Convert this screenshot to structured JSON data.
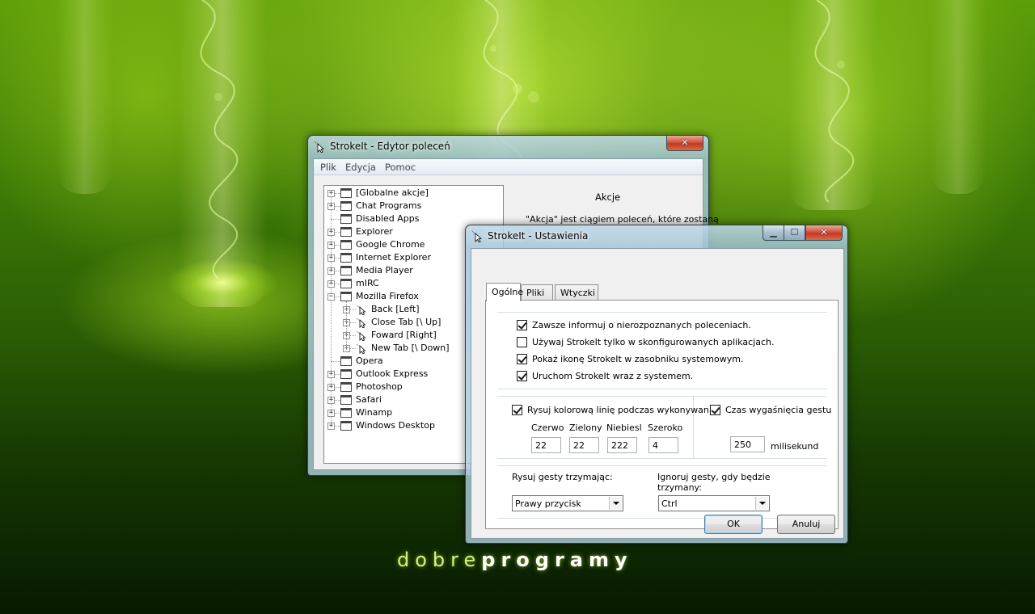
{
  "desktop": {
    "brand_light": "dobre",
    "brand_bold": "programy"
  },
  "editor": {
    "title": "StrokeIt - Edytor poleceń",
    "close_label": "✕",
    "menu": [
      "Plik",
      "Edycja",
      "Pomoc"
    ],
    "tree": [
      {
        "label": "[Globalne akcje]",
        "level": 0,
        "expander": "+",
        "icon": "app"
      },
      {
        "label": "Chat Programs",
        "level": 0,
        "expander": "+",
        "icon": "app"
      },
      {
        "label": "Disabled Apps",
        "level": 0,
        "expander": "",
        "icon": "app"
      },
      {
        "label": "Explorer",
        "level": 0,
        "expander": "+",
        "icon": "app"
      },
      {
        "label": "Google Chrome",
        "level": 0,
        "expander": "+",
        "icon": "app"
      },
      {
        "label": "Internet Explorer",
        "level": 0,
        "expander": "+",
        "icon": "app"
      },
      {
        "label": "Media Player",
        "level": 0,
        "expander": "+",
        "icon": "app"
      },
      {
        "label": "mIRC",
        "level": 0,
        "expander": "+",
        "icon": "app"
      },
      {
        "label": "Mozilla Firefox",
        "level": 0,
        "expander": "−",
        "icon": "app"
      },
      {
        "label": "Back [Left]",
        "level": 1,
        "expander": "+",
        "icon": "gesture"
      },
      {
        "label": "Close Tab [\\ Up]",
        "level": 1,
        "expander": "+",
        "icon": "gesture"
      },
      {
        "label": "Foward [Right]",
        "level": 1,
        "expander": "+",
        "icon": "gesture"
      },
      {
        "label": "New Tab [\\ Down]",
        "level": 1,
        "expander": "+",
        "icon": "gesture"
      },
      {
        "label": "Opera",
        "level": 0,
        "expander": "",
        "icon": "app"
      },
      {
        "label": "Outlook Express",
        "level": 0,
        "expander": "+",
        "icon": "app"
      },
      {
        "label": "Photoshop",
        "level": 0,
        "expander": "+",
        "icon": "app"
      },
      {
        "label": "Safari",
        "level": 0,
        "expander": "+",
        "icon": "app"
      },
      {
        "label": "Winamp",
        "level": 0,
        "expander": "+",
        "icon": "app"
      },
      {
        "label": "Windows Desktop",
        "level": 0,
        "expander": "+",
        "icon": "app"
      }
    ],
    "actions_title": "Akcje",
    "actions_desc": "\"Akcja\" jest ciągiem poleceń, które zostaną"
  },
  "settings": {
    "title": "StrokeIt - Ustawienia",
    "min_label": "▁",
    "max_label": "☐",
    "close_label": "✕",
    "tabs": [
      "Ogólne",
      "Pliki",
      "Wtyczki"
    ],
    "active_tab": 0,
    "options": [
      {
        "label": "Zawsze informuj o nierozpoznanych poleceniach.",
        "checked": true
      },
      {
        "label": "Używaj StrokeIt tylko w skonfigurowanych aplikacjach.",
        "checked": false
      },
      {
        "label": "Pokaż ikonę StrokeIt w zasobniku systemowym.",
        "checked": true
      },
      {
        "label": "Uruchom StrokeIt wraz z systemem.",
        "checked": true
      }
    ],
    "draw_line": {
      "label": "Rysuj kolorową linię podczas wykonywania",
      "checked": true
    },
    "color_fields": [
      {
        "label": "Czerwo",
        "value": "22"
      },
      {
        "label": "Zielony",
        "value": "22"
      },
      {
        "label": "Niebiesl",
        "value": "222"
      },
      {
        "label": "Szeroko",
        "value": "4"
      }
    ],
    "timeout": {
      "label": "Czas wygaśnięcia gestu",
      "checked": true,
      "value": "250",
      "unit": "milisekund"
    },
    "draw_hold": {
      "label": "Rysuj gesty trzymając:",
      "value": "Prawy przycisk"
    },
    "ignore_hold": {
      "label_line1": "Ignoruj gesty, gdy będzie",
      "label_line2": "trzymany:",
      "value": "Ctrl"
    },
    "ok_label": "OK",
    "cancel_label": "Anuluj"
  }
}
